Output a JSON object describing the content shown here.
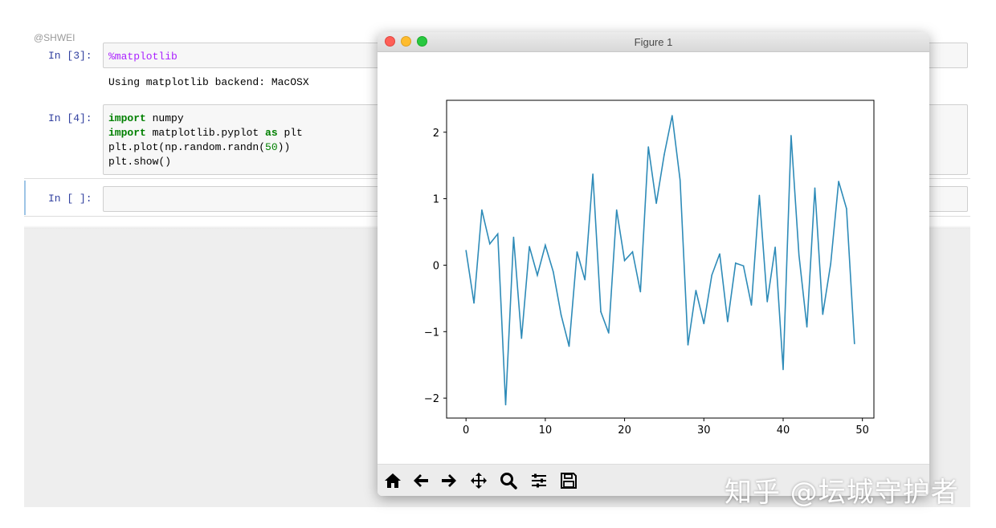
{
  "watermark_top": "@SHWEI",
  "cells": [
    {
      "prompt": "In [3]:",
      "magic": "%matplotlib",
      "output": "Using matplotlib backend: MacOSX"
    },
    {
      "prompt": "In [4]:",
      "lines": [
        {
          "kw": "import",
          "rest": " numpy"
        },
        {
          "kw": "import",
          "rest": " matplotlib.pyplot ",
          "kw2": "as",
          "rest2": " plt"
        },
        {
          "pre": "plt.plot(np.random.randn(",
          "num": "50",
          "post": "))"
        },
        {
          "pre": "plt.show()"
        }
      ]
    },
    {
      "prompt": "In [ ]:"
    }
  ],
  "figure": {
    "title": "Figure 1"
  },
  "toolbar": {
    "icons": [
      "home-icon",
      "back-arrow-icon",
      "forward-arrow-icon",
      "pan-icon",
      "zoom-icon",
      "configure-subplots-icon",
      "save-icon"
    ]
  },
  "watermark_bottom": "知乎 @坛城守护者",
  "chart_data": {
    "type": "line",
    "title": "",
    "xlabel": "",
    "ylabel": "",
    "xlim": [
      -2.45,
      51.45
    ],
    "ylim": [
      -2.3,
      2.48
    ],
    "xticks": [
      0,
      10,
      20,
      30,
      40,
      50
    ],
    "yticks": [
      -2,
      -1,
      0,
      1,
      2
    ],
    "ytick_labels": [
      "−2",
      "−1",
      "0",
      "1",
      "2"
    ],
    "grid": false,
    "color": "#2e8bb8",
    "series": [
      {
        "x": [
          0,
          1,
          2,
          3,
          4,
          5,
          6,
          7,
          8,
          9,
          10,
          11,
          12,
          13,
          14,
          15,
          16,
          17,
          18,
          19,
          20,
          21,
          22,
          23,
          24,
          25,
          26,
          27,
          28,
          29,
          30,
          31,
          32,
          33,
          34,
          35,
          36,
          37,
          38,
          39,
          40,
          41,
          42,
          43,
          44,
          45,
          46,
          47,
          48,
          49
        ],
        "values": [
          0.22,
          -0.57,
          0.83,
          0.32,
          0.47,
          -2.1,
          0.42,
          -1.1,
          0.28,
          -0.15,
          0.3,
          -0.1,
          -0.75,
          -1.22,
          0.2,
          -0.22,
          1.37,
          -0.7,
          -1.02,
          0.83,
          0.07,
          0.2,
          -0.4,
          1.78,
          0.93,
          1.66,
          2.25,
          1.28,
          -1.2,
          -0.38,
          -0.88,
          -0.15,
          0.17,
          -0.85,
          0.03,
          -0.01,
          -0.6,
          1.05,
          -0.55,
          0.27,
          -1.57,
          1.95,
          0.15,
          -0.93,
          1.16,
          -0.74,
          0.02,
          1.26,
          0.85,
          -1.18
        ]
      }
    ]
  }
}
